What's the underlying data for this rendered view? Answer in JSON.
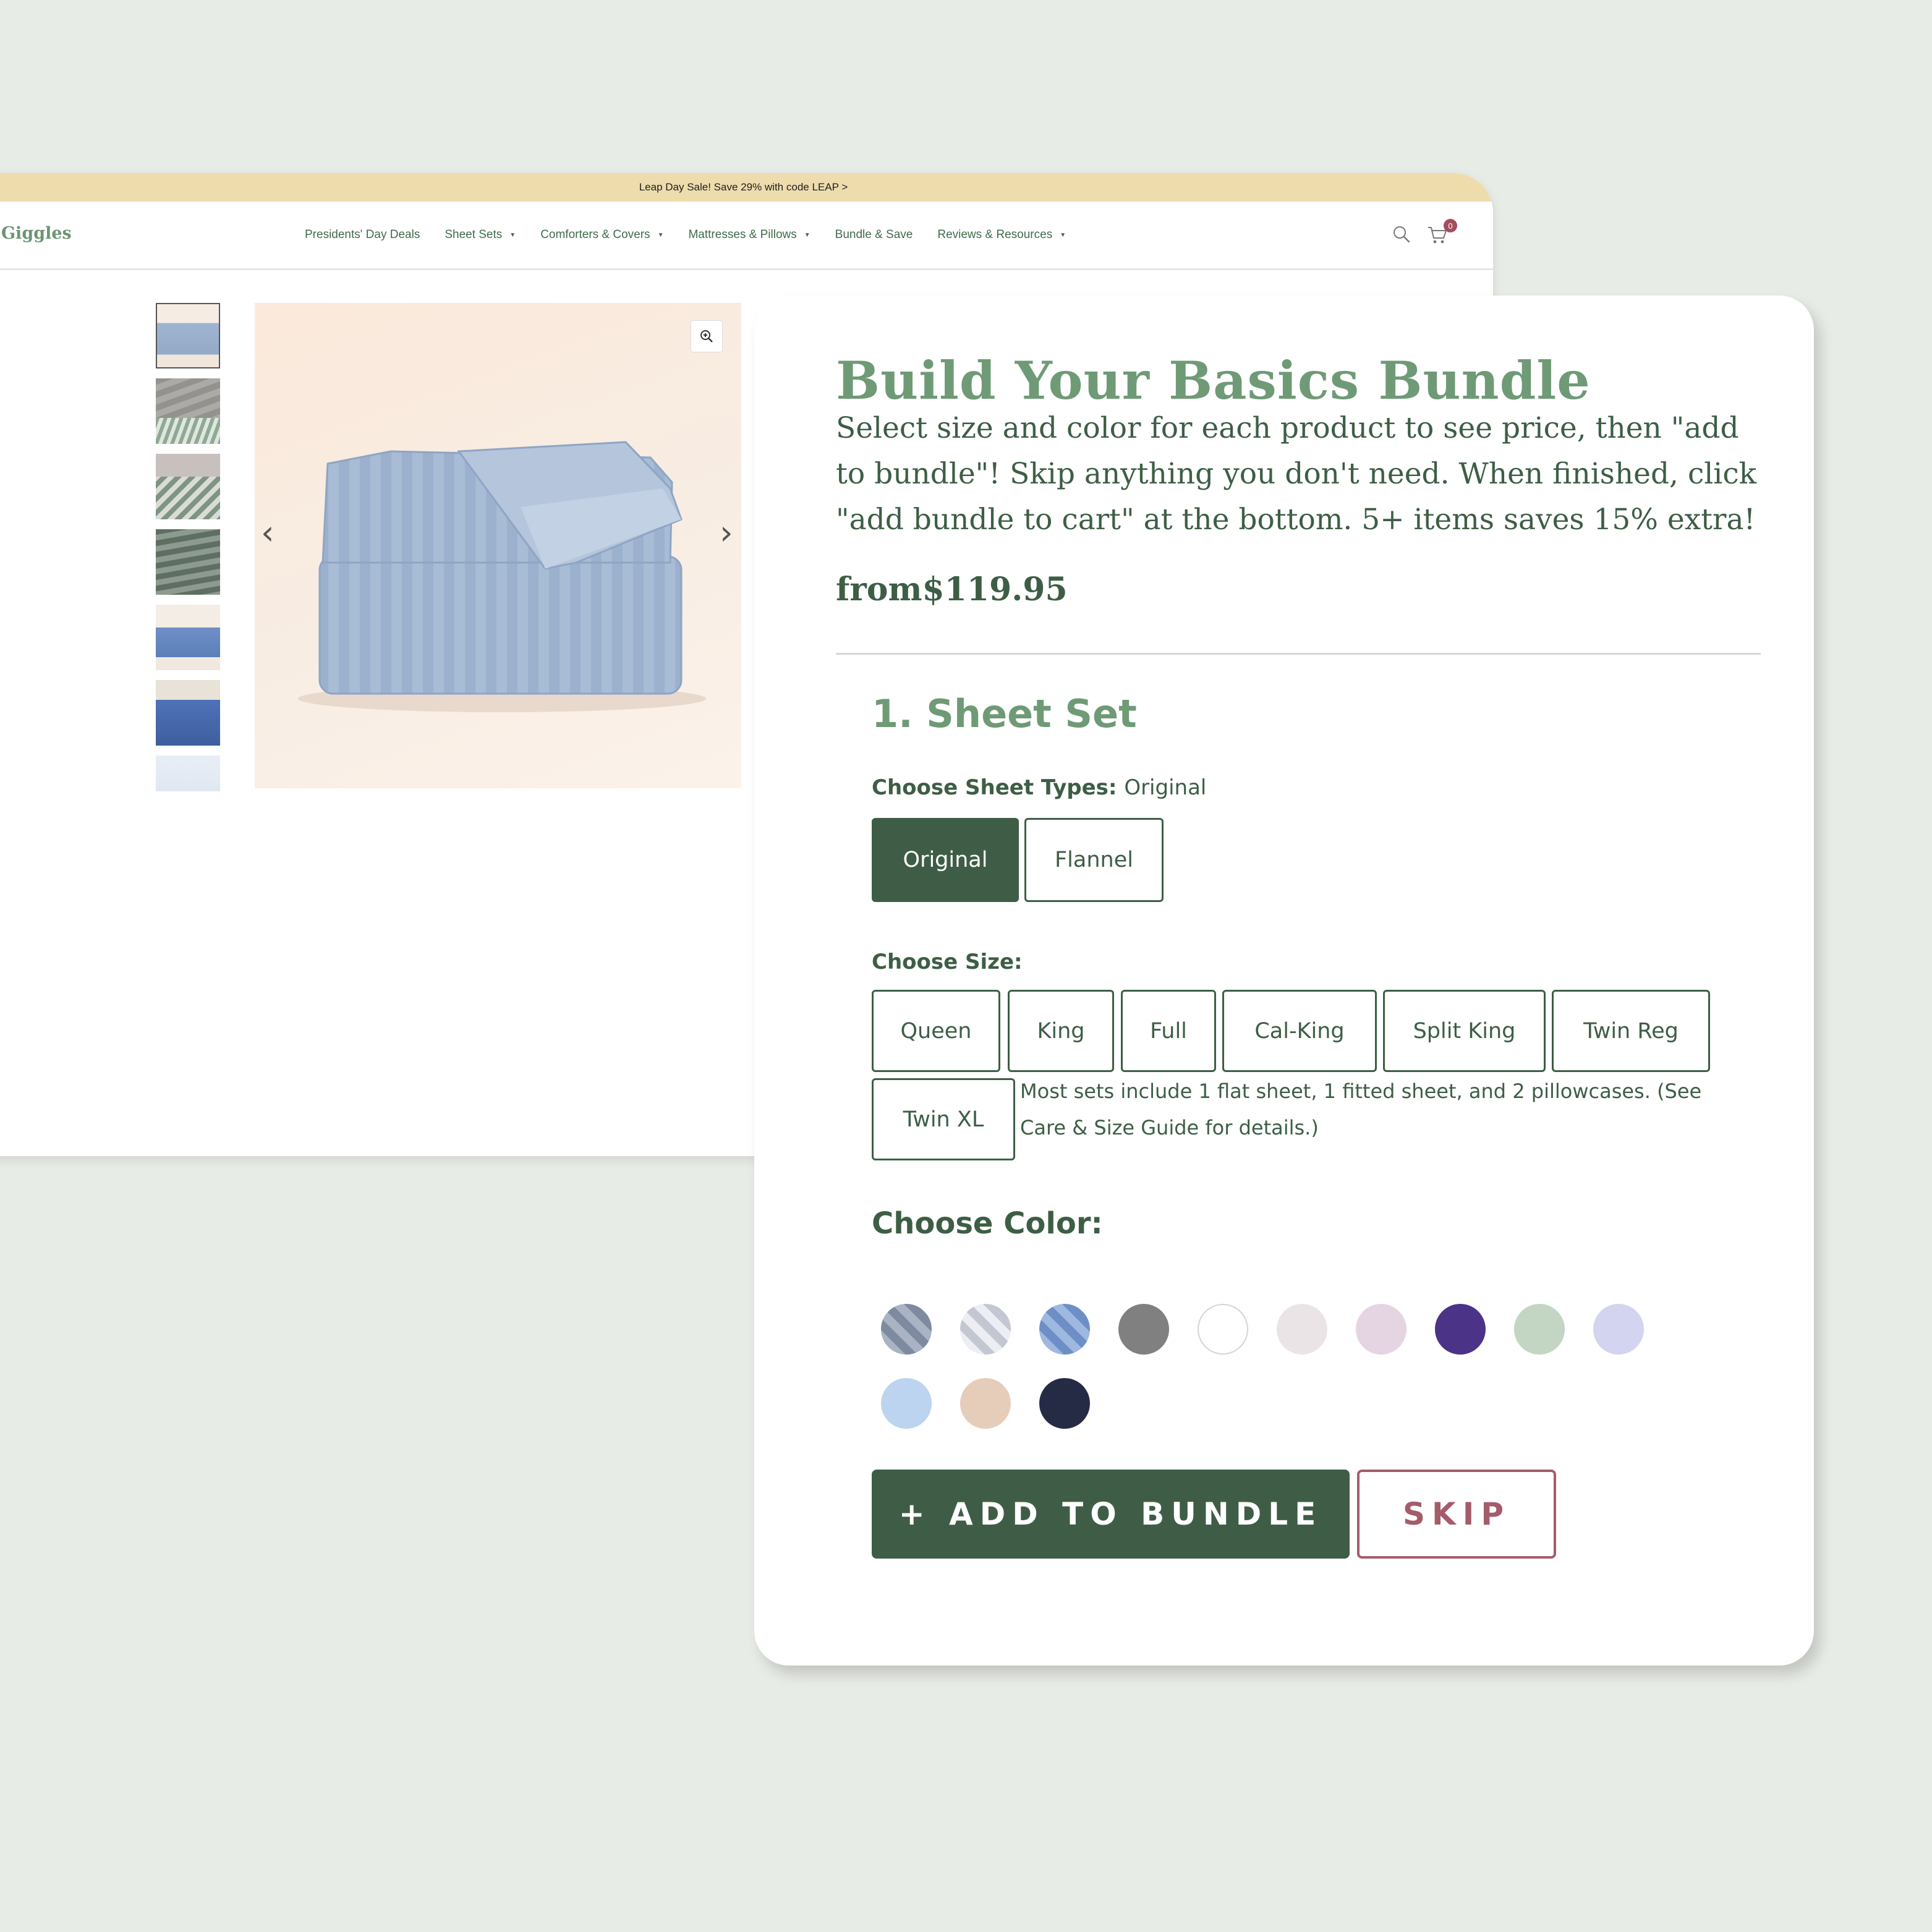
{
  "promo": {
    "text": "Leap Day Sale! Save 29% with code LEAP >"
  },
  "header": {
    "logo": "Giggles",
    "nav": [
      {
        "label": "Presidents' Day Deals",
        "dropdown": false
      },
      {
        "label": "Sheet Sets",
        "dropdown": true
      },
      {
        "label": "Comforters & Covers",
        "dropdown": true
      },
      {
        "label": "Mattresses & Pillows",
        "dropdown": true
      },
      {
        "label": "Bundle & Save",
        "dropdown": false
      },
      {
        "label": "Reviews & Resources",
        "dropdown": true
      }
    ],
    "search_icon": "search-icon",
    "cart_icon": "cart-icon",
    "cart_count": "0"
  },
  "gallery": {
    "thumbnail_count": 7,
    "active_thumbnail": 1,
    "prev_arrow": "‹",
    "next_arrow": "›",
    "zoom_icon": "zoom-in-icon"
  },
  "bundle": {
    "title": "Build Your Basics Bundle",
    "description": "Select size and color for each product to see price, then \"add to bundle\"! Skip anything you don't need. When finished, click \"add bundle to cart\" at the bottom. 5+ items saves 15% extra!",
    "price": "from$119.95",
    "section_title": "1. Sheet Set",
    "sheet_type_label": "Choose Sheet Types:",
    "sheet_type_value": "Original",
    "sheet_types": [
      {
        "label": "Original",
        "selected": true
      },
      {
        "label": "Flannel",
        "selected": false
      }
    ],
    "size_label": "Choose Size:",
    "sizes": [
      "Queen",
      "King",
      "Full",
      "Cal-King",
      "Split King",
      "Twin Reg",
      "Twin XL"
    ],
    "size_note": "Most sets include 1 flat sheet, 1 fitted sheet, and 2 pillowcases. (See Care & Size Guide for details.)",
    "color_label": "Choose Color:",
    "colors": [
      {
        "name": "navy-stripe",
        "color": "#7d8aa0",
        "stripe": "#aab3c4"
      },
      {
        "name": "light-gray-stripe",
        "color": "#c3c7d2",
        "stripe": "#eceef3"
      },
      {
        "name": "blue-stripe",
        "color": "#6e8fc6",
        "stripe": "#9fb8e0"
      },
      {
        "name": "gray",
        "color": "#808080"
      },
      {
        "name": "white",
        "color": "#ffffff"
      },
      {
        "name": "light-pink",
        "color": "#ebe4e6"
      },
      {
        "name": "lilac",
        "color": "#e5d5e2"
      },
      {
        "name": "purple",
        "color": "#4b3388"
      },
      {
        "name": "sage",
        "color": "#c2d6c3"
      },
      {
        "name": "lavender",
        "color": "#d3d4ef"
      },
      {
        "name": "sky-blue",
        "color": "#bcd4ef"
      },
      {
        "name": "sand",
        "color": "#e6cdba"
      },
      {
        "name": "midnight",
        "color": "#262b45"
      }
    ],
    "add_button": "+ ADD TO BUNDLE",
    "skip_button": "SKIP"
  }
}
